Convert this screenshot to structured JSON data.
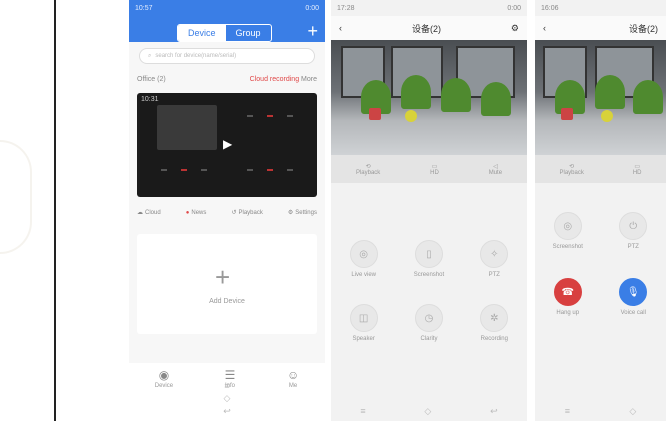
{
  "phone1": {
    "status_time": "10:57",
    "status_right": "0:00",
    "tab_device": "Device",
    "tab_group": "Group",
    "search_placeholder": "search for device(name/serial)",
    "office_label": "Office",
    "office_sub": "(2)",
    "cloud_recording": "Cloud recording",
    "more": "More",
    "video_time": "10:31",
    "tools": [
      "Cloud",
      "News",
      "Playback",
      "Settings"
    ],
    "add_device": "Add Device",
    "nav": [
      "Device",
      "Info",
      "Me"
    ]
  },
  "phone2": {
    "status_time": "17:28",
    "status_right": "0:00",
    "title": "设备(2)",
    "subbar": [
      "Playback",
      "HD",
      "Mute"
    ],
    "controls": [
      "Live view",
      "Screenshot",
      "PTZ",
      "Speaker",
      "Clarity",
      "Recording"
    ]
  },
  "phone3": {
    "status_time": "16:06",
    "title": "设备(2)",
    "subbar": [
      "Playback",
      "HD"
    ],
    "controls": [
      "Screenshot",
      "PTZ",
      "Hang up",
      "Voice call"
    ]
  }
}
